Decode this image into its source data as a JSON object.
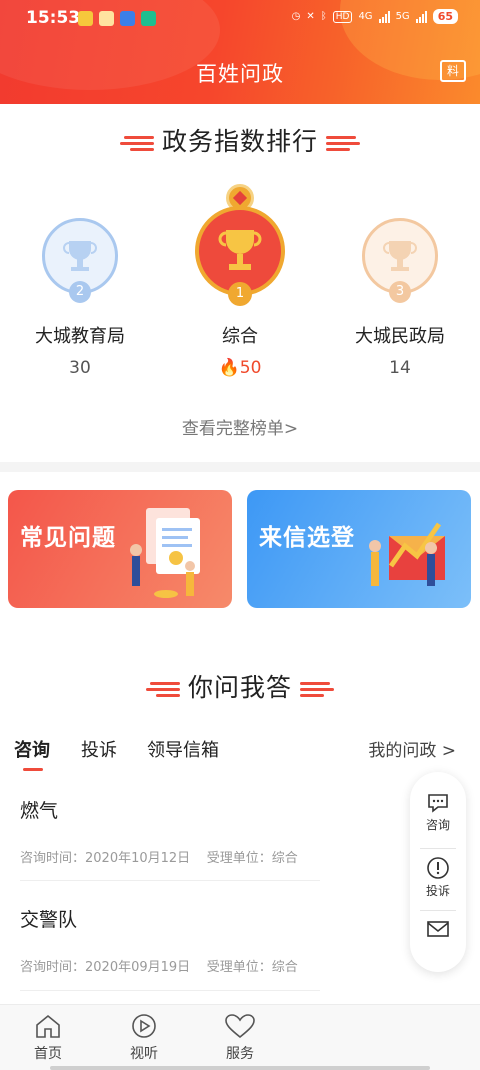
{
  "status_bar": {
    "time": "15:53",
    "network_a": "4G",
    "network_b": "5G",
    "hd": "HD",
    "battery": "65"
  },
  "header": {
    "title": "百姓问政",
    "news_icon_label": "料"
  },
  "ranking": {
    "title": "政务指数排行",
    "entries": [
      {
        "rank": "2",
        "name": "大城教育局",
        "score": "30",
        "icon": "silver-trophy-icon"
      },
      {
        "rank": "1",
        "name": "综合",
        "score": "50",
        "icon": "gold-trophy-icon",
        "hot": true
      },
      {
        "rank": "3",
        "name": "大城民政局",
        "score": "14",
        "icon": "bronze-trophy-icon"
      }
    ],
    "view_full": "查看完整榜单>"
  },
  "cards": {
    "faq": {
      "label": "常见问题",
      "color": "#f4564a"
    },
    "letters": {
      "label": "来信选登",
      "color": "#4aa3f7"
    }
  },
  "qa": {
    "title": "你问我答",
    "tabs": [
      "咨询",
      "投诉",
      "领导信箱"
    ],
    "active_tab": "咨询",
    "my_link": "我的问政 >",
    "items": [
      {
        "title": "燃气",
        "time_label": "咨询时间：",
        "time": "2020年10月12日",
        "unit_label": "受理单位：",
        "unit": "综合"
      },
      {
        "title": "交警队",
        "time_label": "咨询时间：",
        "time": "2020年09月19日",
        "unit_label": "受理单位：",
        "unit": "综合"
      }
    ]
  },
  "float_menu": {
    "items": [
      {
        "label": "咨询",
        "icon": "chat-bubble-icon"
      },
      {
        "label": "投诉",
        "icon": "alert-circle-icon"
      },
      {
        "label": "",
        "icon": "mail-icon"
      }
    ]
  },
  "bottom_nav": {
    "items": [
      {
        "label": "首页",
        "icon": "home-icon"
      },
      {
        "label": "视听",
        "icon": "play-icon"
      },
      {
        "label": "服务",
        "icon": "heart-icon"
      }
    ]
  },
  "colors": {
    "brand_red": "#f23a2f",
    "accent_orange": "#fb8a2c",
    "gold": "#f0a830",
    "silver": "#a9c8ef",
    "bronze": "#f3c8a0"
  }
}
